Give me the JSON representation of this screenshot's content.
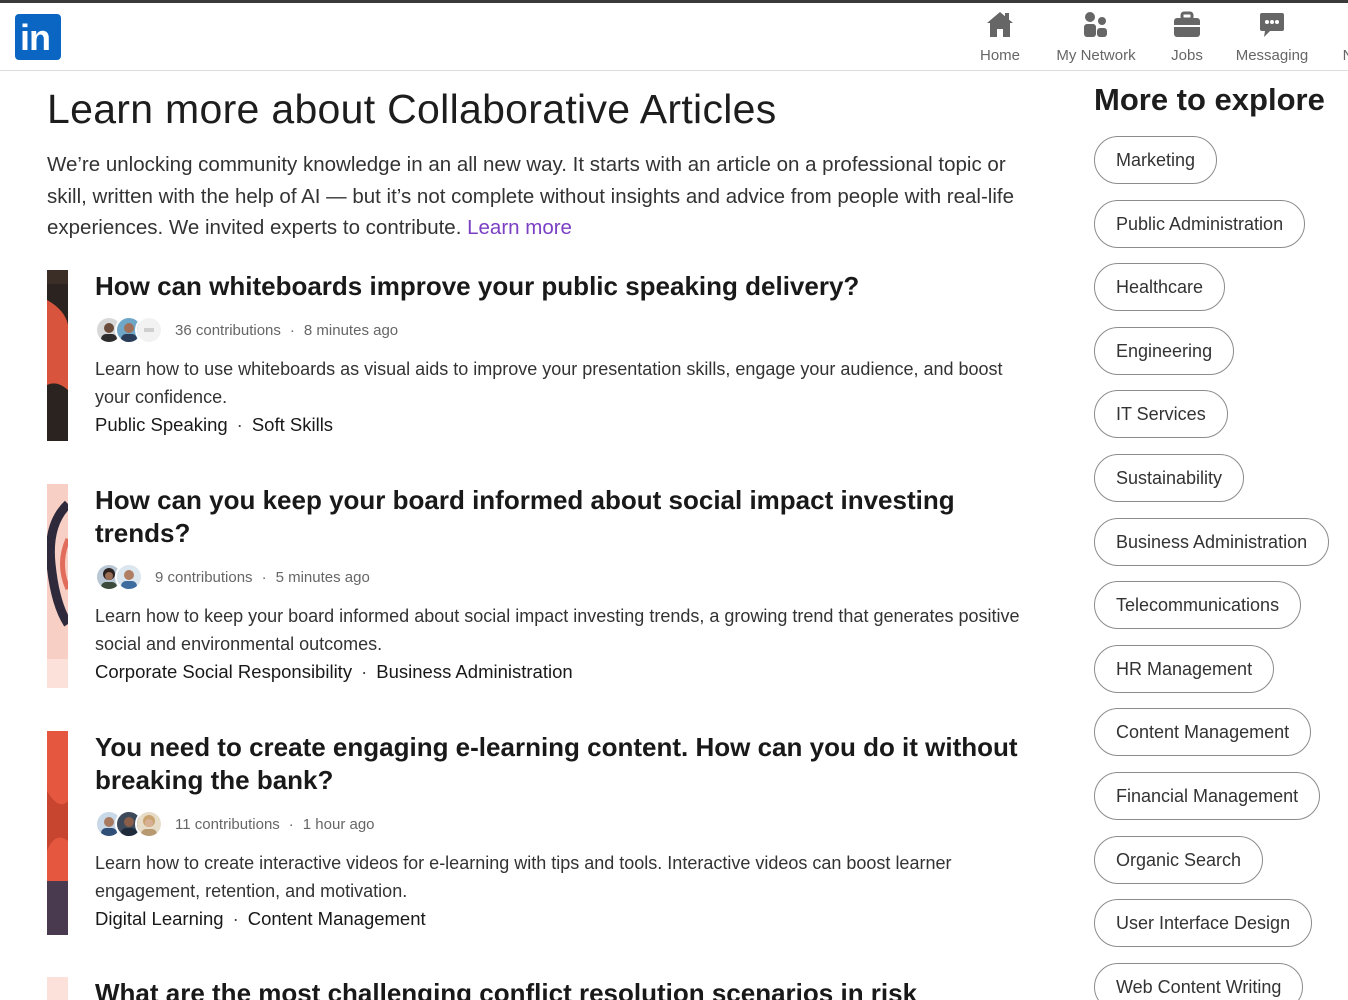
{
  "header": {
    "logo_text": "in",
    "nav": [
      {
        "label": "Home",
        "icon": "home-icon"
      },
      {
        "label": "My Network",
        "icon": "network-icon"
      },
      {
        "label": "Jobs",
        "icon": "briefcase-icon"
      },
      {
        "label": "Messaging",
        "icon": "messaging-icon"
      },
      {
        "label": "N",
        "icon": ""
      }
    ]
  },
  "main": {
    "title": "Learn more about Collaborative Articles",
    "intro": "We’re unlocking community knowledge in an all new way. It starts with an article on a professional topic or skill, written with the help of AI — but it’s not complete without insights and advice from people with real-life experiences. We invited experts to contribute.",
    "learn_more": "Learn more",
    "articles": [
      {
        "title": "How can whiteboards improve your public speaking delivery?",
        "contributions": "36 contributions",
        "time": "8 minutes ago",
        "description": "Learn how to use whiteboards as visual aids to improve your presentation skills, engage your audience, and boost your confidence.",
        "tags": [
          "Public Speaking",
          "Soft Skills"
        ]
      },
      {
        "title": "How can you keep your board informed about social impact investing trends?",
        "contributions": "9 contributions",
        "time": "5 minutes ago",
        "description": "Learn how to keep your board informed about social impact investing trends, a growing trend that generates positive social and environmental outcomes.",
        "tags": [
          "Corporate Social Responsibility",
          "Business Administration"
        ]
      },
      {
        "title": "You need to create engaging e-learning content. How can you do it without breaking the bank?",
        "contributions": "11 contributions",
        "time": "1 hour ago",
        "description": "Learn how to create interactive videos for e-learning with tips and tools. Interactive videos can boost learner engagement, retention, and motivation.",
        "tags": [
          "Digital Learning",
          "Content Management"
        ]
      },
      {
        "title": "What are the most challenging conflict resolution scenarios in risk"
      }
    ]
  },
  "sidebar": {
    "title": "More to explore",
    "chips": [
      "Marketing",
      "Public Administration",
      "Healthcare",
      "Engineering",
      "IT Services",
      "Sustainability",
      "Business Administration",
      "Telecommunications",
      "HR Management",
      "Content Management",
      "Financial Management",
      "Organic Search",
      "User Interface Design",
      "Web Content Writing"
    ]
  },
  "colors": {
    "brand": "#0a66c2",
    "link": "#7b3fc4"
  }
}
